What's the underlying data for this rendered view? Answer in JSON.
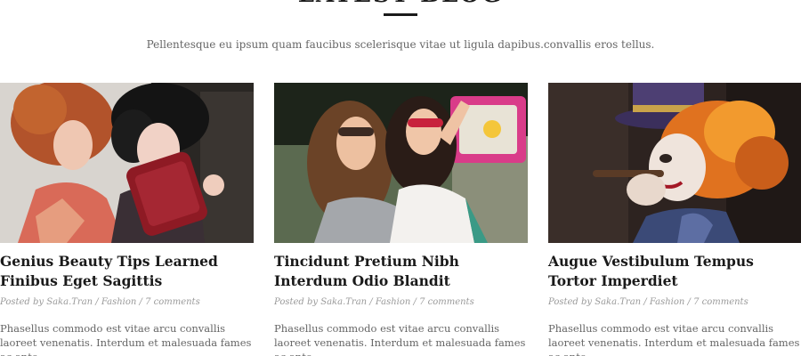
{
  "section": {
    "title": "LATEST BLOG",
    "subtitle": "Pellentesque eu ipsum quam faucibus scelerisque vitae ut ligula dapibus.convallis eros tellus."
  },
  "colors": {
    "heading": "#1a1a1a",
    "meta": "#9a9a9a",
    "body_text": "#666666"
  },
  "posts": [
    {
      "image": "fashion-models-photo",
      "title": "Genius Beauty Tips Learned Finibus Eget Sagittis",
      "meta": {
        "prefix": "Posted by",
        "author": "Saka.Tran",
        "sep1": "/",
        "category": "Fashion",
        "sep2": "/",
        "comments": "7 comments"
      },
      "excerpt": "Phasellus commodo est vitae arcu convallis laoreet venenatis. Interdum et malesuada fames ac ante"
    },
    {
      "image": "summer-girls-photo",
      "title": "Tincidunt Pretium Nibh Interdum Odio Blandit",
      "meta": {
        "prefix": "Posted by",
        "author": "Saka.Tran",
        "sep1": "/",
        "category": "Fashion",
        "sep2": "/",
        "comments": "7 comments"
      },
      "excerpt": "Phasellus commodo est vitae arcu convallis laoreet venenatis. Interdum et malesuada fames ac ante"
    },
    {
      "image": "costume-portrait-photo",
      "title": "Augue Vestibulum Tempus Tortor Imperdiet",
      "meta": {
        "prefix": "Posted by",
        "author": "Saka.Tran",
        "sep1": "/",
        "category": "Fashion",
        "sep2": "/",
        "comments": "7 comments"
      },
      "excerpt": "Phasellus commodo est vitae arcu convallis laoreet venenatis. Interdum et malesuada fames ac ante"
    }
  ]
}
